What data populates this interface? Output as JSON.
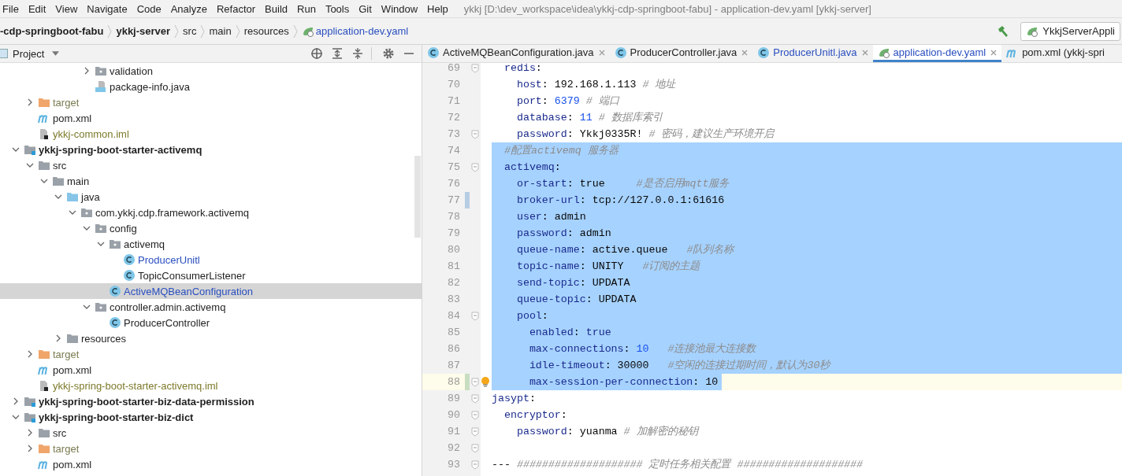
{
  "menu": [
    {
      "label": "File"
    },
    {
      "label": "Edit"
    },
    {
      "label": "View"
    },
    {
      "label": "Navigate"
    },
    {
      "label": "Code"
    },
    {
      "label": "Analyze"
    },
    {
      "label": "Refactor"
    },
    {
      "label": "Build"
    },
    {
      "label": "Run"
    },
    {
      "label": "Tools"
    },
    {
      "label": "Git"
    },
    {
      "label": "Window"
    },
    {
      "label": "Help"
    }
  ],
  "window": {
    "title": "ykkj [D:\\dev_workspace\\idea\\ykkj-cdp-springboot-fabu] - application-dev.yaml [ykkj-server]"
  },
  "breadcrumbs": [
    {
      "label": "-cdp-springboot-fabu",
      "kind": "project"
    },
    {
      "label": "ykkj-server",
      "kind": "project"
    },
    {
      "label": "src",
      "kind": "folder"
    },
    {
      "label": "main",
      "kind": "folder"
    },
    {
      "label": "resources",
      "kind": "folder"
    },
    {
      "label": "application-dev.yaml",
      "kind": "yaml"
    }
  ],
  "run_config": {
    "label": "YkkjServerAppli"
  },
  "project_panel": {
    "title": "Project"
  },
  "tree": [
    {
      "children": [
        {
          "children": [
            {
              "children": [
                {
                  "children": [
                    {
                      "children": [
                        {
                          "label": "validation",
                          "kind": "package",
                          "expanded": false,
                          "selected": false,
                          "modified": false
                        },
                        {
                          "label": "package-info.java",
                          "kind": "java-file",
                          "selected": false,
                          "modified": false
                        }
                      ]
                    }
                  ]
                }
              ]
            }
          ]
        },
        {
          "label": "target",
          "kind": "excluded",
          "expanded": false,
          "selected": false,
          "modified": false
        },
        {
          "label": "pom.xml",
          "kind": "maven",
          "selected": false,
          "modified": false
        },
        {
          "label": "ykkj-common.iml",
          "kind": "iml",
          "selected": false,
          "modified": false
        }
      ]
    },
    {
      "label": "ykkj-spring-boot-starter-activemq",
      "kind": "module",
      "expanded": true,
      "selected": false,
      "modified": false,
      "children": [
        {
          "label": "src",
          "kind": "folder",
          "expanded": true,
          "selected": false,
          "modified": false,
          "children": [
            {
              "label": "main",
              "kind": "folder",
              "expanded": true,
              "selected": false,
              "modified": false,
              "children": [
                {
                  "label": "java",
                  "kind": "source",
                  "expanded": true,
                  "selected": false,
                  "modified": false,
                  "children": [
                    {
                      "label": "com.ykkj.cdp.framework.activemq",
                      "kind": "package",
                      "expanded": true,
                      "selected": false,
                      "modified": false,
                      "children": [
                        {
                          "label": "config",
                          "kind": "package",
                          "expanded": true,
                          "selected": false,
                          "modified": false,
                          "children": [
                            {
                              "label": "activemq",
                              "kind": "package",
                              "expanded": true,
                              "selected": false,
                              "modified": false,
                              "children": [
                                {
                                  "label": "ProducerUnitl",
                                  "kind": "class",
                                  "selected": false,
                                  "modified": true
                                },
                                {
                                  "label": "TopicConsumerListener",
                                  "kind": "class",
                                  "selected": false,
                                  "modified": false
                                }
                              ]
                            },
                            {
                              "label": "ActiveMQBeanConfiguration",
                              "kind": "class",
                              "selected": true,
                              "modified": true
                            }
                          ]
                        },
                        {
                          "label": "controller.admin.activemq",
                          "kind": "package",
                          "expanded": true,
                          "selected": false,
                          "modified": false,
                          "children": [
                            {
                              "label": "ProducerController",
                              "kind": "class",
                              "selected": false,
                              "modified": false
                            }
                          ]
                        }
                      ]
                    }
                  ]
                },
                {
                  "label": "resources",
                  "kind": "folder",
                  "expanded": false,
                  "selected": false,
                  "modified": false
                }
              ]
            }
          ]
        },
        {
          "label": "target",
          "kind": "excluded",
          "expanded": false,
          "selected": false,
          "modified": false
        },
        {
          "label": "pom.xml",
          "kind": "maven",
          "selected": false,
          "modified": false
        },
        {
          "label": "ykkj-spring-boot-starter-activemq.iml",
          "kind": "iml",
          "selected": false,
          "modified": false
        }
      ]
    },
    {
      "label": "ykkj-spring-boot-starter-biz-data-permission",
      "kind": "module",
      "expanded": false,
      "selected": false,
      "modified": false
    },
    {
      "label": "ykkj-spring-boot-starter-biz-dict",
      "kind": "module",
      "expanded": true,
      "selected": false,
      "modified": false,
      "children": [
        {
          "label": "src",
          "kind": "folder",
          "expanded": false,
          "selected": false,
          "modified": false
        },
        {
          "label": "target",
          "kind": "excluded",
          "expanded": false,
          "selected": false,
          "modified": false
        },
        {
          "label": "pom.xml",
          "kind": "maven",
          "selected": false,
          "modified": false
        }
      ]
    }
  ],
  "tabs": [
    {
      "label": "ActiveMQBeanConfiguration.java",
      "kind": "class",
      "selected": false,
      "modified": false,
      "closable": true
    },
    {
      "label": "ProducerController.java",
      "kind": "class",
      "selected": false,
      "modified": false,
      "closable": true
    },
    {
      "label": "ProducerUnitl.java",
      "kind": "class",
      "selected": false,
      "modified": true,
      "closable": true
    },
    {
      "label": "application-dev.yaml",
      "kind": "yaml",
      "selected": true,
      "modified": true,
      "closable": true
    },
    {
      "label": "pom.xml (ykkj-spri",
      "kind": "maven",
      "selected": false,
      "modified": false,
      "closable": false
    }
  ],
  "code": [
    {
      "number": "69",
      "fold": true,
      "selected": false,
      "current": false,
      "segments": [
        {
          "kind": "key",
          "text": "  redis"
        },
        {
          "kind": "plain",
          "text": ":"
        }
      ]
    },
    {
      "number": "70",
      "fold": false,
      "selected": false,
      "current": false,
      "segments": [
        {
          "kind": "key",
          "text": "    host"
        },
        {
          "kind": "plain",
          "text": ": 192.168.1.113 "
        },
        {
          "kind": "comment",
          "text": "# 地址"
        }
      ]
    },
    {
      "number": "71",
      "fold": false,
      "selected": false,
      "current": false,
      "segments": [
        {
          "kind": "key",
          "text": "    port"
        },
        {
          "kind": "plain",
          "text": ": "
        },
        {
          "kind": "number",
          "text": "6379"
        },
        {
          "kind": "comment",
          "text": " # 端口"
        }
      ]
    },
    {
      "number": "72",
      "fold": false,
      "selected": false,
      "current": false,
      "segments": [
        {
          "kind": "key",
          "text": "    database"
        },
        {
          "kind": "plain",
          "text": ": "
        },
        {
          "kind": "number",
          "text": "11"
        },
        {
          "kind": "comment",
          "text": " # 数据库索引"
        }
      ]
    },
    {
      "number": "73",
      "fold": true,
      "selected": false,
      "current": false,
      "segments": [
        {
          "kind": "key",
          "text": "    password"
        },
        {
          "kind": "plain",
          "text": ": Ykkj0335R! "
        },
        {
          "kind": "comment",
          "text": "# 密码，建议生产环境开启"
        }
      ]
    },
    {
      "number": "74",
      "fold": false,
      "selected": true,
      "current": false,
      "segments": [
        {
          "kind": "comment",
          "text": "  #配置activemq 服务器"
        }
      ]
    },
    {
      "number": "75",
      "fold": true,
      "selected": true,
      "current": false,
      "segments": [
        {
          "kind": "key",
          "text": "  activemq"
        },
        {
          "kind": "plain",
          "text": ":"
        }
      ]
    },
    {
      "number": "76",
      "fold": false,
      "selected": true,
      "current": false,
      "segments": [
        {
          "kind": "key",
          "text": "    or-start"
        },
        {
          "kind": "plain",
          "text": ": true     "
        },
        {
          "kind": "comment",
          "text": "#是否启用mqtt服务"
        }
      ]
    },
    {
      "number": "77",
      "fold": false,
      "selected": true,
      "current": false,
      "change": {
        "kind": "modified"
      },
      "segments": [
        {
          "kind": "key",
          "text": "    broker-url"
        },
        {
          "kind": "plain",
          "text": ": tcp://127.0.0.1:61616"
        }
      ]
    },
    {
      "number": "78",
      "fold": false,
      "selected": true,
      "current": false,
      "segments": [
        {
          "kind": "key",
          "text": "    user"
        },
        {
          "kind": "plain",
          "text": ": admin"
        }
      ]
    },
    {
      "number": "79",
      "fold": false,
      "selected": true,
      "current": false,
      "segments": [
        {
          "kind": "key",
          "text": "    password"
        },
        {
          "kind": "plain",
          "text": ": admin"
        }
      ]
    },
    {
      "number": "80",
      "fold": false,
      "selected": true,
      "current": false,
      "segments": [
        {
          "kind": "key",
          "text": "    queue-name"
        },
        {
          "kind": "plain",
          "text": ": active.queue   "
        },
        {
          "kind": "comment",
          "text": "#队列名称"
        }
      ]
    },
    {
      "number": "81",
      "fold": false,
      "selected": true,
      "current": false,
      "segments": [
        {
          "kind": "key",
          "text": "    topic-name"
        },
        {
          "kind": "plain",
          "text": ": UNITY   "
        },
        {
          "kind": "comment",
          "text": "#订阅的主题"
        }
      ]
    },
    {
      "number": "82",
      "fold": false,
      "selected": true,
      "current": false,
      "segments": [
        {
          "kind": "key",
          "text": "    send-topic"
        },
        {
          "kind": "plain",
          "text": ": UPDATA"
        }
      ]
    },
    {
      "number": "83",
      "fold": false,
      "selected": true,
      "current": false,
      "segments": [
        {
          "kind": "key",
          "text": "    queue-topic"
        },
        {
          "kind": "plain",
          "text": ": UPDATA"
        }
      ]
    },
    {
      "number": "84",
      "fold": true,
      "selected": true,
      "current": false,
      "segments": [
        {
          "kind": "key",
          "text": "    pool"
        },
        {
          "kind": "plain",
          "text": ":"
        }
      ]
    },
    {
      "number": "85",
      "fold": false,
      "selected": true,
      "current": false,
      "segments": [
        {
          "kind": "key",
          "text": "      enabled"
        },
        {
          "kind": "plain",
          "text": ": "
        },
        {
          "kind": "key",
          "text": "true"
        }
      ]
    },
    {
      "number": "86",
      "fold": false,
      "selected": true,
      "current": false,
      "segments": [
        {
          "kind": "key",
          "text": "      max-connections"
        },
        {
          "kind": "plain",
          "text": ": "
        },
        {
          "kind": "number",
          "text": "10"
        },
        {
          "kind": "comment",
          "text": "   #连接池最大连接数"
        }
      ]
    },
    {
      "number": "87",
      "fold": false,
      "selected": true,
      "current": false,
      "segments": [
        {
          "kind": "key",
          "text": "      idle-timeout"
        },
        {
          "kind": "plain",
          "text": ": 30000   "
        },
        {
          "kind": "comment",
          "text": "#空闲的连接过期时间，默认为30秒"
        }
      ]
    },
    {
      "number": "88",
      "fold": true,
      "selected": true,
      "current": true,
      "change": {
        "kind": "added"
      },
      "segments": [
        {
          "kind": "key",
          "text": "      max-session-per-connection"
        },
        {
          "kind": "plain",
          "text": ": 10"
        }
      ]
    },
    {
      "number": "89",
      "fold": true,
      "selected": false,
      "current": false,
      "segments": [
        {
          "kind": "key",
          "text": "jasypt"
        },
        {
          "kind": "plain",
          "text": ":"
        }
      ]
    },
    {
      "number": "90",
      "fold": true,
      "selected": false,
      "current": false,
      "segments": [
        {
          "kind": "key",
          "text": "  encryptor"
        },
        {
          "kind": "plain",
          "text": ":"
        }
      ]
    },
    {
      "number": "91",
      "fold": true,
      "selected": false,
      "current": false,
      "segments": [
        {
          "kind": "key",
          "text": "    password"
        },
        {
          "kind": "plain",
          "text": ": yuanma "
        },
        {
          "kind": "comment",
          "text": "# 加解密的秘钥"
        }
      ]
    },
    {
      "number": "92",
      "fold": true,
      "selected": false,
      "current": false
    },
    {
      "number": "93",
      "fold": true,
      "selected": false,
      "current": false,
      "segments": [
        {
          "kind": "plain",
          "text": "--- "
        },
        {
          "kind": "comment",
          "text": "#################### 定时任务相关配置 ####################"
        }
      ]
    }
  ]
}
